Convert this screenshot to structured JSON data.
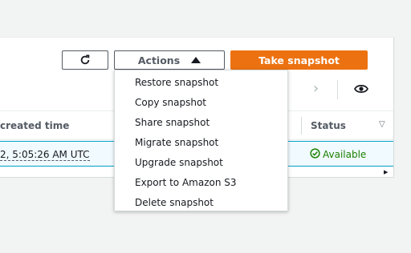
{
  "toolbar": {
    "refresh_icon": "refresh-icon",
    "actions_label": "Actions",
    "actions_caret_icon": "caret-up-icon",
    "take_snapshot_label": "Take snapshot"
  },
  "pagination": {
    "next_icon": "chevron-right-icon",
    "settings_icon": "eye-icon"
  },
  "table": {
    "columns": {
      "created_time": "created time",
      "status": "Status"
    },
    "sort_icon": "sort-down-icon",
    "rows": [
      {
        "created_time": "2, 5:05:26 AM UTC",
        "status": "Available",
        "status_icon": "check-circle-icon"
      }
    ]
  },
  "actions_menu": {
    "items": [
      {
        "label": "Restore snapshot"
      },
      {
        "label": "Copy snapshot"
      },
      {
        "label": "Share snapshot"
      },
      {
        "label": "Migrate snapshot"
      },
      {
        "label": "Upgrade snapshot"
      },
      {
        "label": "Export to Amazon S3"
      },
      {
        "label": "Delete snapshot"
      }
    ]
  },
  "colors": {
    "primary_orange": "#ec7211",
    "status_green": "#1d8102",
    "selection_blue": "#00a1c9",
    "selection_bg": "#f1faff"
  }
}
